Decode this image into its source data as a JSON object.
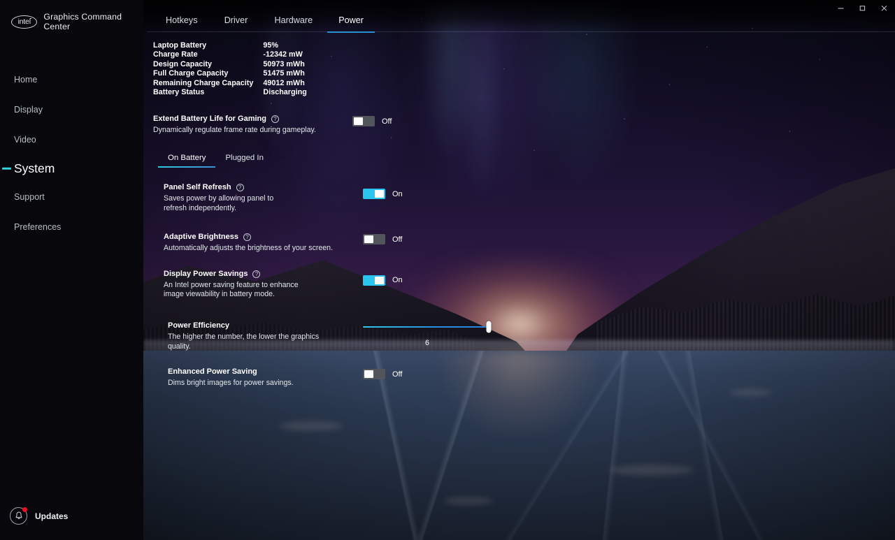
{
  "window": {
    "app_name": "Graphics Command Center",
    "logo_text": "intel",
    "controls": {
      "minimize": "minimize-icon",
      "maximize": "restore-icon",
      "close": "close-icon"
    }
  },
  "sidebar": {
    "items": [
      {
        "label": "Home",
        "active": false
      },
      {
        "label": "Display",
        "active": false
      },
      {
        "label": "Video",
        "active": false
      },
      {
        "label": "System",
        "active": true
      },
      {
        "label": "Support",
        "active": false
      },
      {
        "label": "Preferences",
        "active": false
      }
    ],
    "updates": {
      "label": "Updates",
      "icon": "bell-icon",
      "badge": true
    }
  },
  "top_tabs": [
    {
      "label": "Hotkeys",
      "active": false
    },
    {
      "label": "Driver",
      "active": false
    },
    {
      "label": "Hardware",
      "active": false
    },
    {
      "label": "Power",
      "active": true
    }
  ],
  "battery_stats": [
    {
      "key": "Laptop Battery",
      "value": "95%"
    },
    {
      "key": "Charge Rate",
      "value": "-12342 mW"
    },
    {
      "key": "Design Capacity",
      "value": "50973 mWh"
    },
    {
      "key": "Full Charge Capacity",
      "value": "51475 mWh"
    },
    {
      "key": "Remaining Charge Capacity",
      "value": "49012 mWh"
    },
    {
      "key": "Battery Status",
      "value": "Discharging"
    }
  ],
  "extend_battery": {
    "title": "Extend Battery Life for Gaming",
    "desc": "Dynamically regulate frame rate during gameplay.",
    "toggle_state": "Off",
    "toggle_on": false
  },
  "power_source_tabs": [
    {
      "label": "On Battery",
      "active": true
    },
    {
      "label": "Plugged In",
      "active": false
    }
  ],
  "settings": {
    "panel_self_refresh": {
      "title": "Panel Self Refresh",
      "desc": "Saves power by allowing panel to refresh independently.",
      "toggle_state": "On",
      "toggle_on": true
    },
    "adaptive_brightness": {
      "title": "Adaptive Brightness",
      "desc": "Automatically adjusts the brightness of your screen.",
      "toggle_state": "Off",
      "toggle_on": false
    },
    "display_power_savings": {
      "title": "Display Power Savings",
      "desc": "An Intel power saving feature to enhance image viewability in battery mode.",
      "toggle_state": "On",
      "toggle_on": true
    },
    "power_efficiency": {
      "title": "Power Efficiency",
      "desc": "The higher the number, the lower the graphics quality.",
      "value": "6",
      "min": 1,
      "max": 6,
      "percent": 98
    },
    "enhanced_power_saving": {
      "title": "Enhanced Power Saving",
      "desc": "Dims bright images for power savings.",
      "toggle_state": "Off",
      "toggle_on": false
    }
  },
  "colors": {
    "accent_cyan": "#29c5ee",
    "accent_blue": "#2a8fd0",
    "badge_red": "#e81123",
    "sidebar_bg": "#08080c"
  }
}
